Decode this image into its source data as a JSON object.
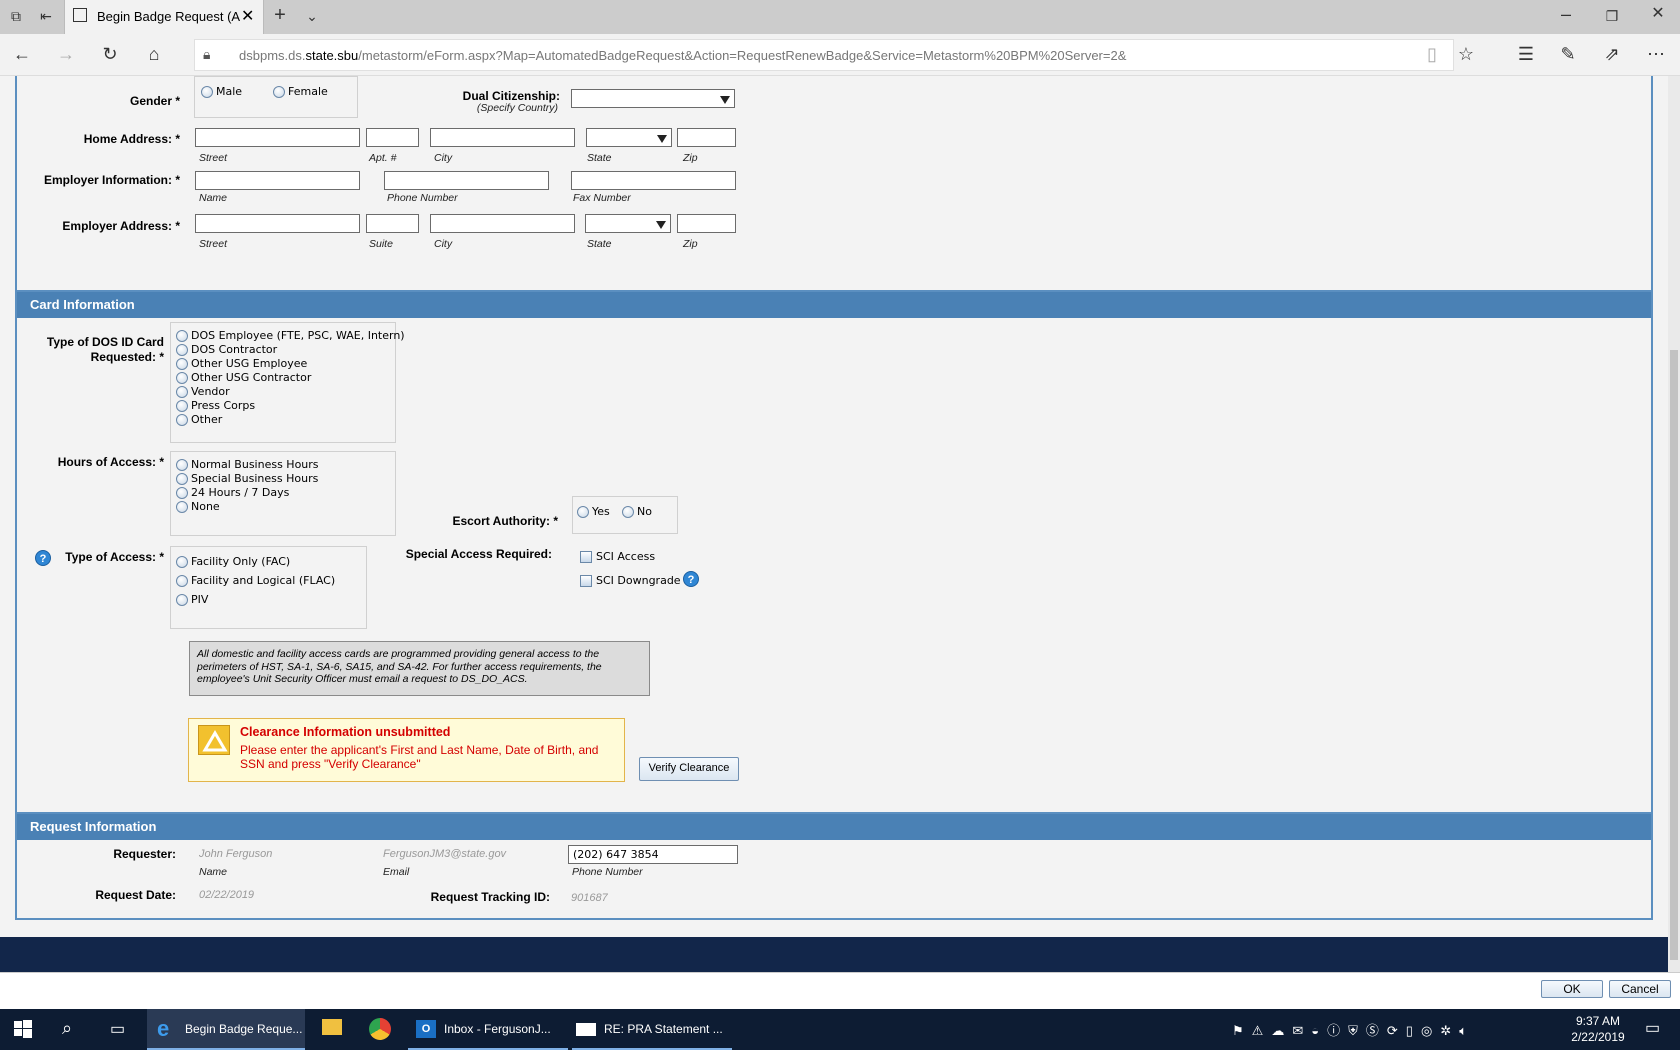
{
  "browser": {
    "tab_title": "Begin Badge Request (A",
    "url_prefix": "dsbpms.ds.",
    "url_domain": "state.sbu",
    "url_path": "/metastorm/eForm.aspx?Map=AutomatedBadgeRequest&Action=RequestRenewBadge&Service=Metastorm%20BPM%20Server=2&"
  },
  "personal": {
    "gender_label": "Gender *",
    "gender_male": "Male",
    "gender_female": "Female",
    "dual_citizenship_label": "Dual Citizenship:",
    "dual_citizenship_sub": "(Specify Country)",
    "home_address_label": "Home Address: *",
    "home_sub_street": "Street",
    "home_sub_apt": "Apt. #",
    "home_sub_city": "City",
    "home_sub_state": "State",
    "home_sub_zip": "Zip",
    "employer_info_label": "Employer Information: *",
    "emp_sub_name": "Name",
    "emp_sub_phone": "Phone Number",
    "emp_sub_fax": "Fax Number",
    "employer_address_label": "Employer Address: *",
    "ea_sub_street": "Street",
    "ea_sub_suite": "Suite",
    "ea_sub_city": "City",
    "ea_sub_state": "State",
    "ea_sub_zip": "Zip"
  },
  "card": {
    "header": "Card Information",
    "type_label_1": "Type of DOS ID Card",
    "type_label_2": "Requested: *",
    "type_options": [
      "DOS Employee (FTE, PSC, WAE, Intern)",
      "DOS Contractor",
      "Other USG Employee",
      "Other USG Contractor",
      "Vendor",
      "Press Corps",
      "Other"
    ],
    "hours_label": "Hours of Access: *",
    "hours_options": [
      "Normal Business Hours",
      "Special Business Hours",
      "24 Hours / 7 Days",
      "None"
    ],
    "escort_label": "Escort Authority: *",
    "escort_yes": "Yes",
    "escort_no": "No",
    "access_label": "Type of Access: *",
    "access_options": [
      "Facility Only (FAC)",
      "Facility and Logical (FLAC)",
      "PIV"
    ],
    "special_label": "Special Access Required:",
    "special_options": [
      "SCI Access",
      "SCI Downgrade"
    ],
    "note": "All domestic and facility access cards are programmed providing general access to the perimeters of HST, SA-1, SA-6, SA15, and SA-42. For further access requirements, the employee's Unit Security Officer must email a request to DS_DO_ACS.",
    "warning_title": "Clearance Information unsubmitted",
    "warning_text": "Please enter the applicant's First and Last Name, Date of Birth, and SSN and press \"Verify Clearance\"",
    "verify_button": "Verify Clearance"
  },
  "request": {
    "header": "Request Information",
    "requester_label": "Requester:",
    "requester_name": "John Ferguson",
    "requester_email": "FergusonJM3@state.gov",
    "requester_phone": "(202) 647 3854",
    "sub_name": "Name",
    "sub_email": "Email",
    "sub_phone": "Phone Number",
    "date_label": "Request Date:",
    "date_value": "02/22/2019",
    "tracking_label": "Request Tracking ID:",
    "tracking_value": "901687"
  },
  "footer": {
    "ok": "OK",
    "cancel": "Cancel"
  },
  "taskbar": {
    "edge_item": "Begin Badge Reque...",
    "outlook_item": "Inbox - FergusonJ...",
    "mail_item": "RE: PRA Statement ...",
    "time": "9:37 AM",
    "date": "2/22/2019"
  }
}
